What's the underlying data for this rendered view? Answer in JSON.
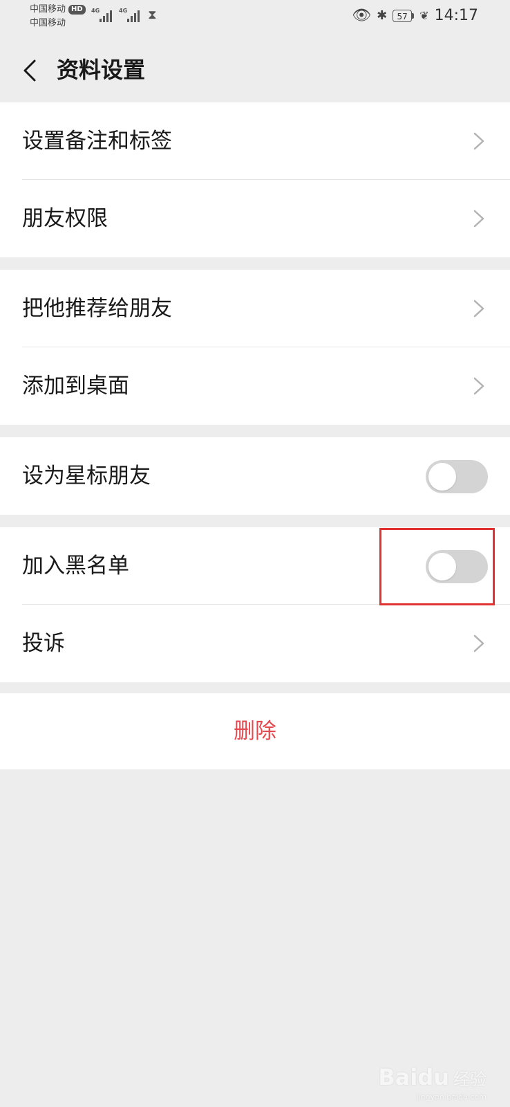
{
  "status_bar": {
    "carrier_1": "中国移动",
    "hd_badge": "HD",
    "carrier_2": "中国移动",
    "network_1": "4G",
    "network_2": "4G",
    "battery": "57",
    "time": "14:17"
  },
  "nav": {
    "title": "资料设置"
  },
  "groups": [
    {
      "items": [
        {
          "label": "设置备注和标签"
        },
        {
          "label": "朋友权限"
        }
      ]
    },
    {
      "items": [
        {
          "label": "把他推荐给朋友"
        },
        {
          "label": "添加到桌面"
        }
      ]
    },
    {
      "items": [
        {
          "label": "设为星标朋友",
          "toggle": false
        }
      ]
    },
    {
      "items": [
        {
          "label": "加入黑名单",
          "toggle": false
        },
        {
          "label": "投诉"
        }
      ]
    }
  ],
  "delete": {
    "label": "删除"
  },
  "watermark": {
    "logo": "Baidu",
    "text": "经验",
    "url": "jingyan.baidu.com"
  },
  "colors": {
    "background": "#ededed",
    "delete_text": "#e5484d",
    "highlight": "#e03030",
    "toggle_off": "#d4d4d4"
  }
}
